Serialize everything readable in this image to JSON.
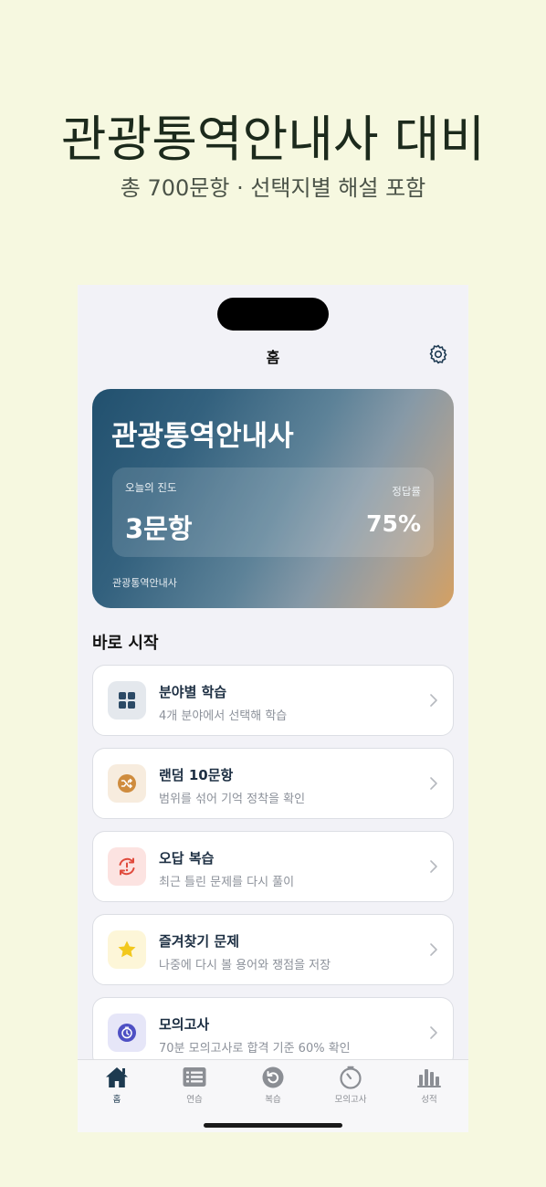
{
  "promo": {
    "title": "관광통역안내사 대비",
    "subtitle": "총 700문항 · 선택지별 해설 포함"
  },
  "nav": {
    "title": "홈",
    "settings_icon": "gear-icon"
  },
  "hero": {
    "title": "관광통역안내사",
    "progress_label": "오늘의 진도",
    "progress_value": "3문항",
    "accuracy_label": "정답률",
    "accuracy_value": "75%",
    "footer": "관광통역안내사",
    "gradient_colors": [
      "#21506e",
      "#5d8298",
      "#d4a062"
    ]
  },
  "quick_start": {
    "title": "바로 시작",
    "items": [
      {
        "title": "분야별 학습",
        "subtitle": "4개 분야에서 선택해 학습",
        "icon": "grid-icon",
        "icon_color": "#2c4a66",
        "icon_bg": "#e4e8ed"
      },
      {
        "title": "랜덤 10문항",
        "subtitle": "범위를 섞어 기억 정착을 확인",
        "icon": "shuffle-icon",
        "icon_color": "#cf8c3e",
        "icon_bg": "#f7ecde"
      },
      {
        "title": "오답 복습",
        "subtitle": "최근 틀린 문제를 다시 풀이",
        "icon": "retry-icon",
        "icon_color": "#e04a3c",
        "icon_bg": "#fce3e1"
      },
      {
        "title": "즐겨찾기 문제",
        "subtitle": "나중에 다시 볼 용어와 쟁점을 저장",
        "icon": "star-icon",
        "icon_color": "#f2c81d",
        "icon_bg": "#fdf6d8"
      },
      {
        "title": "모의고사",
        "subtitle": "70분 모의고사로 합격 기준 60% 확인",
        "icon": "timer-icon",
        "icon_color": "#4e50c4",
        "icon_bg": "#e6e6f8"
      }
    ]
  },
  "tabs": [
    {
      "label": "홈",
      "icon": "house-icon",
      "active": true
    },
    {
      "label": "연습",
      "icon": "list-icon",
      "active": false
    },
    {
      "label": "복습",
      "icon": "replay-icon",
      "active": false
    },
    {
      "label": "모의고사",
      "icon": "stopwatch-icon",
      "active": false
    },
    {
      "label": "성적",
      "icon": "bar-chart-icon",
      "active": false
    }
  ],
  "colors": {
    "background": "#f6f8e0",
    "accent": "#1d3a50",
    "inactive": "#8b8e94"
  }
}
